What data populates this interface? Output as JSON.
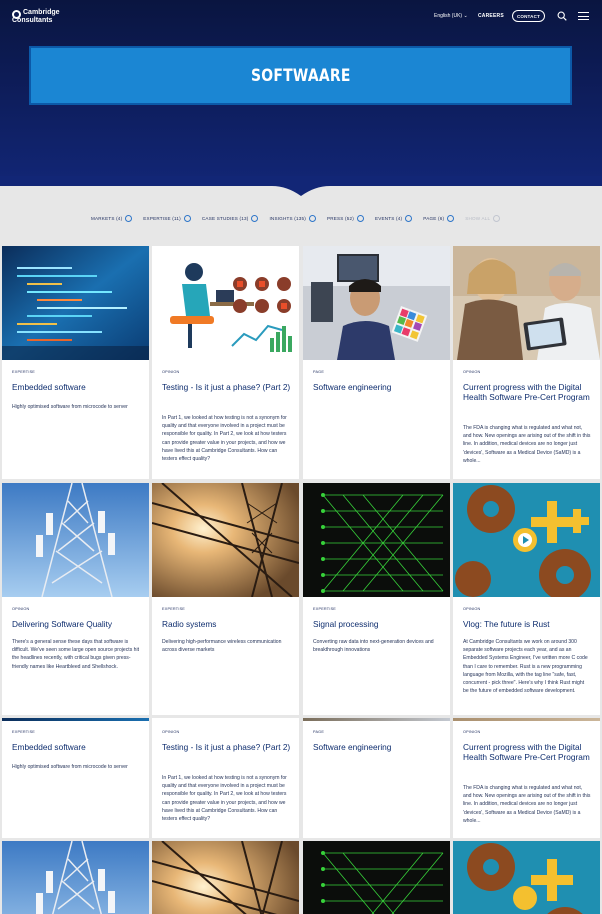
{
  "header": {
    "logo_line1": "Cambridge",
    "logo_line2": "Consultants",
    "language": "English (UK) ⌄",
    "careers": "CAREERS",
    "contact": "CONTACT"
  },
  "banner": {
    "title": "SOFTWAARE"
  },
  "filters": [
    {
      "label": "MARKETS (4)"
    },
    {
      "label": "EXPERTISE (11)"
    },
    {
      "label": "CASE STUDIES (13)"
    },
    {
      "label": "INSIGHTS (135)"
    },
    {
      "label": "PRESS (52)"
    },
    {
      "label": "EVENTS (4)"
    },
    {
      "label": "PAGE (6)"
    },
    {
      "label": "SHOW ALL"
    }
  ],
  "cards_row1": [
    {
      "tag": "EXPERTISE",
      "title": "Embedded software",
      "desc": "Highly optimised software from microcode to server"
    },
    {
      "tag": "OPINION",
      "title": "Testing - Is it just a phase? (Part 2)",
      "desc": "In Part 1, we looked at how testing is not a synonym for quality and that everyone involved in a project must be responsible for quality. In Part 2, we look at how testers can provide greater value in your projects, and how we have lived this at Cambridge Consultants. How can testers effect quality?"
    },
    {
      "tag": "PAGE",
      "title": "Software engineering",
      "desc": ""
    },
    {
      "tag": "OPINION",
      "title": "Current progress with the Digital Health Software Pre-Cert Program",
      "desc": "The FDA is changing what is regulated and what not, and how. New openings are arising out of the shift in this line. In addition, medical devices are no longer just 'devices', Software as a Medical Device (SaMD) is a whole..."
    }
  ],
  "cards_row2": [
    {
      "tag": "OPINION",
      "title": "Delivering Software Quality",
      "desc": "There's a general sense these days that software is difficult. We've seen some large open source projects hit the headlines recently, with critical bugs given press-friendly names like Heartbleed and Shellshock."
    },
    {
      "tag": "EXPERTISE",
      "title": "Radio systems",
      "desc": "Delivering high-performance wireless communication across diverse markets"
    },
    {
      "tag": "EXPERTISE",
      "title": "Signal processing",
      "desc": "Converting raw data into next-generation devices and breakthrough innovations"
    },
    {
      "tag": "OPINION",
      "title": "Vlog: The future is Rust",
      "desc": "At Cambridge Consultants we work on around 300 separate software projects each year, and as an Embedded Systems Engineer, I've written more C code than I care to remember. Rust is a new programming language from Mozilla, with the tag line \"safe, fast, concurrent - pick three\". Here's why I think Rust might be the future of embedded software development."
    }
  ],
  "cards_row3": [
    {
      "tag": "EXPERTISE",
      "title": "Embedded software",
      "desc": "Highly optimised software from microcode to server"
    },
    {
      "tag": "OPINION",
      "title": "Testing - Is it just a phase? (Part 2)",
      "desc": "In Part 1, we looked at how testing is not a synonym for quality and that everyone involved in a project must be responsible for quality. In Part 2, we look at how testers can provide greater value in your projects, and how we have lived this at Cambridge Consultants. How can testers effect quality?"
    },
    {
      "tag": "PAGE",
      "title": "Software engineering",
      "desc": ""
    },
    {
      "tag": "OPINION",
      "title": "Current progress with the Digital Health Software Pre-Cert Program",
      "desc": "The FDA is changing what is regulated and what not, and how. New openings are arising out of the shift in this line. In addition, medical devices are no longer just 'devices', Software as a Medical Device (SaMD) is a whole..."
    }
  ],
  "colors": {
    "hero_dark": "#0a1540",
    "banner_blue": "#1b86d3",
    "card_title": "#0e2d6e",
    "filter_circle": "#2e76c9"
  },
  "icons": {
    "search": "search-icon",
    "menu": "hamburger-menu-icon",
    "logo": "cambridge-consultants-logo",
    "play": "play-icon"
  }
}
